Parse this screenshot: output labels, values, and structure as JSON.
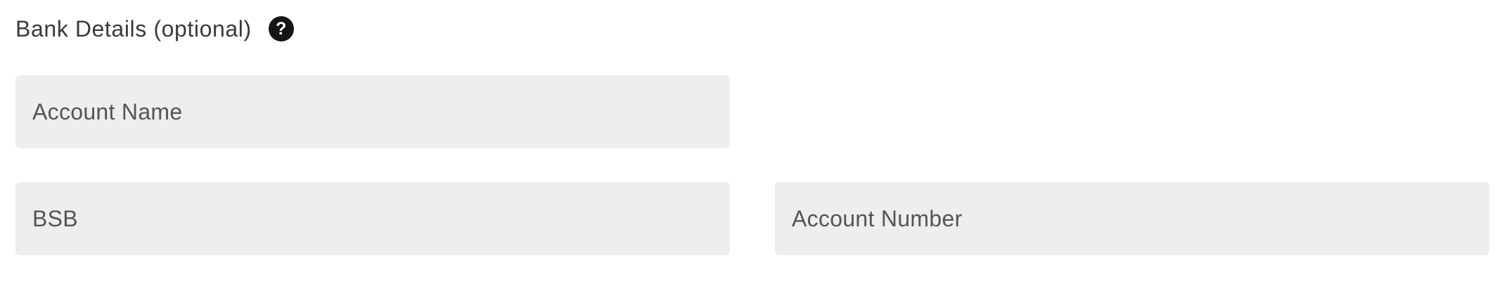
{
  "section": {
    "title": "Bank Details (optional)",
    "help_icon": "question-mark-icon",
    "help_glyph": "?"
  },
  "fields": {
    "account_name": {
      "placeholder": "Account Name",
      "value": ""
    },
    "bsb": {
      "placeholder": "BSB",
      "value": ""
    },
    "account_number": {
      "placeholder": "Account Number",
      "value": ""
    }
  },
  "colors": {
    "field_background": "#eeeeee",
    "help_icon_background": "#151515",
    "text": "#3a3a3a"
  }
}
